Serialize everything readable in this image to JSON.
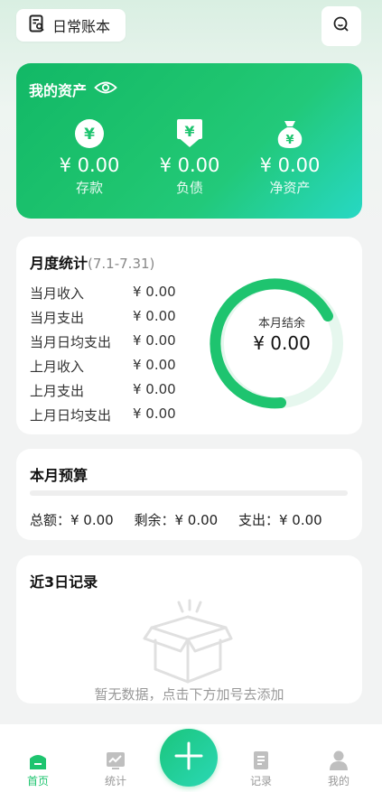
{
  "header": {
    "ledger_name": "日常账本",
    "ledger_icon": "ledger-search-icon",
    "search_icon": "search-icon"
  },
  "assets": {
    "title": "我的资产",
    "eye_icon": "eye-icon",
    "items": [
      {
        "icon": "yen-coin-icon",
        "amount": "¥ 0.00",
        "label": "存款"
      },
      {
        "icon": "yen-bill-icon",
        "amount": "¥ 0.00",
        "label": "负债"
      },
      {
        "icon": "money-bag-icon",
        "amount": "¥ 0.00",
        "label": "净资产"
      }
    ]
  },
  "monthly": {
    "title": "月度统计",
    "range": "(7.1-7.31)",
    "rows": [
      {
        "label": "当月收入",
        "value": "¥ 0.00"
      },
      {
        "label": "当月支出",
        "value": "¥ 0.00"
      },
      {
        "label": "当月日均支出",
        "value": "¥ 0.00"
      },
      {
        "label": "上月收入",
        "value": "¥ 0.00"
      },
      {
        "label": "上月支出",
        "value": "¥ 0.00"
      },
      {
        "label": "上月日均支出",
        "value": "¥ 0.00"
      }
    ],
    "ring_label": "本月结余",
    "ring_value": "¥ 0.00"
  },
  "budget": {
    "title": "本月预算",
    "progress": 0,
    "total": "总额：¥ 0.00",
    "remaining": "剩余：¥ 0.00",
    "spent": "支出：¥ 0.00"
  },
  "recent": {
    "title": "近3日记录",
    "empty_icon": "empty-box-icon",
    "empty_text": "暂无数据，点击下方加号去添加"
  },
  "tabbar": {
    "tabs": [
      {
        "label": "首页",
        "icon": "home-icon",
        "active": true
      },
      {
        "label": "统计",
        "icon": "chart-icon",
        "active": false
      },
      {
        "label": "记录",
        "icon": "records-icon",
        "active": false
      },
      {
        "label": "我的",
        "icon": "profile-icon",
        "active": false
      }
    ],
    "add_icon": "plus-icon"
  },
  "colors": {
    "accent": "#1ec46f",
    "accent_light": "#e6f7ee",
    "gradient_end": "#27d8c4"
  }
}
